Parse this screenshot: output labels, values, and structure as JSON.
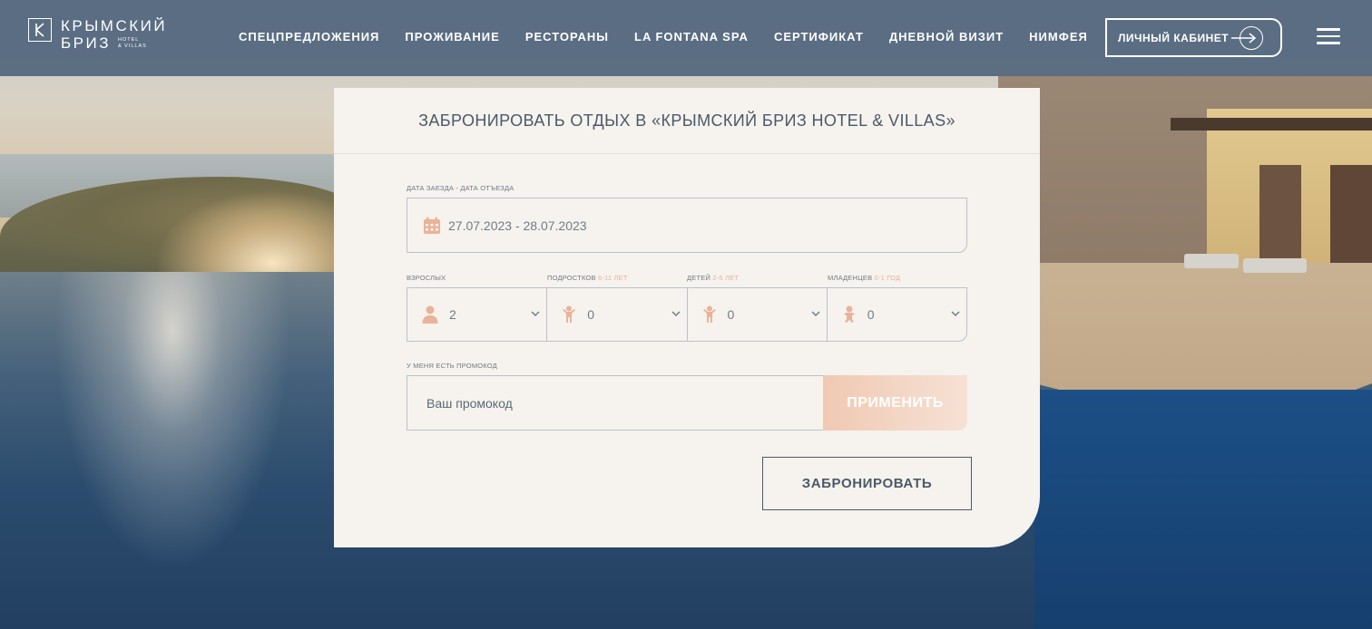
{
  "brand": {
    "name_line1": "КРЫМСКИЙ",
    "name_line2": "БРИЗ",
    "sub_line1": "HOTEL",
    "sub_line2": "& VILLAS",
    "logo_icon": "k-monogram-icon"
  },
  "nav": {
    "items": [
      {
        "label": "СПЕЦПРЕДЛОЖЕНИЯ"
      },
      {
        "label": "ПРОЖИВАНИЕ"
      },
      {
        "label": "РЕСТОРАНЫ"
      },
      {
        "label": "LA FONTANA SPA"
      },
      {
        "label": "СЕРТИФИКАТ"
      },
      {
        "label": "ДНЕВНОЙ ВИЗИТ"
      },
      {
        "label": "НИМФЕЯ"
      }
    ],
    "cabinet_label": "ЛИЧНЫЙ КАБИНЕТ",
    "cabinet_icon": "arrow-right-circle-icon",
    "menu_icon": "hamburger-icon"
  },
  "booking": {
    "title": "ЗАБРОНИРОВАТЬ ОТДЫХ В «КРЫМСКИЙ БРИЗ HOTEL & VILLAS»",
    "dates_label": "ДАТА ЗАЕЗДА - ДАТА ОТЪЕЗДА",
    "dates_value": "27.07.2023 - 28.07.2023",
    "guests": [
      {
        "label": "ВЗРОСЛЫХ",
        "age": "",
        "value": "2",
        "icon": "adult-icon"
      },
      {
        "label": "ПОДРОСТКОВ",
        "age": "6-11 ЛЕТ",
        "value": "0",
        "icon": "teen-icon"
      },
      {
        "label": "ДЕТЕЙ",
        "age": "2-5 ЛЕТ",
        "value": "0",
        "icon": "child-icon"
      },
      {
        "label": "МЛАДЕНЦЕВ",
        "age": "0-1 ГОД",
        "value": "0",
        "icon": "infant-icon"
      }
    ],
    "promo_label": "У МЕНЯ ЕСТЬ ПРОМОКОД",
    "promo_placeholder": "Ваш промокод",
    "apply_label": "ПРИМЕНИТЬ",
    "submit_label": "ЗАБРОНИРОВАТЬ"
  },
  "colors": {
    "header_bg": "#4a6078",
    "card_bg": "#f6f2ee",
    "accent_peach": "#e8b39a",
    "text_slate": "#4a5a68"
  }
}
